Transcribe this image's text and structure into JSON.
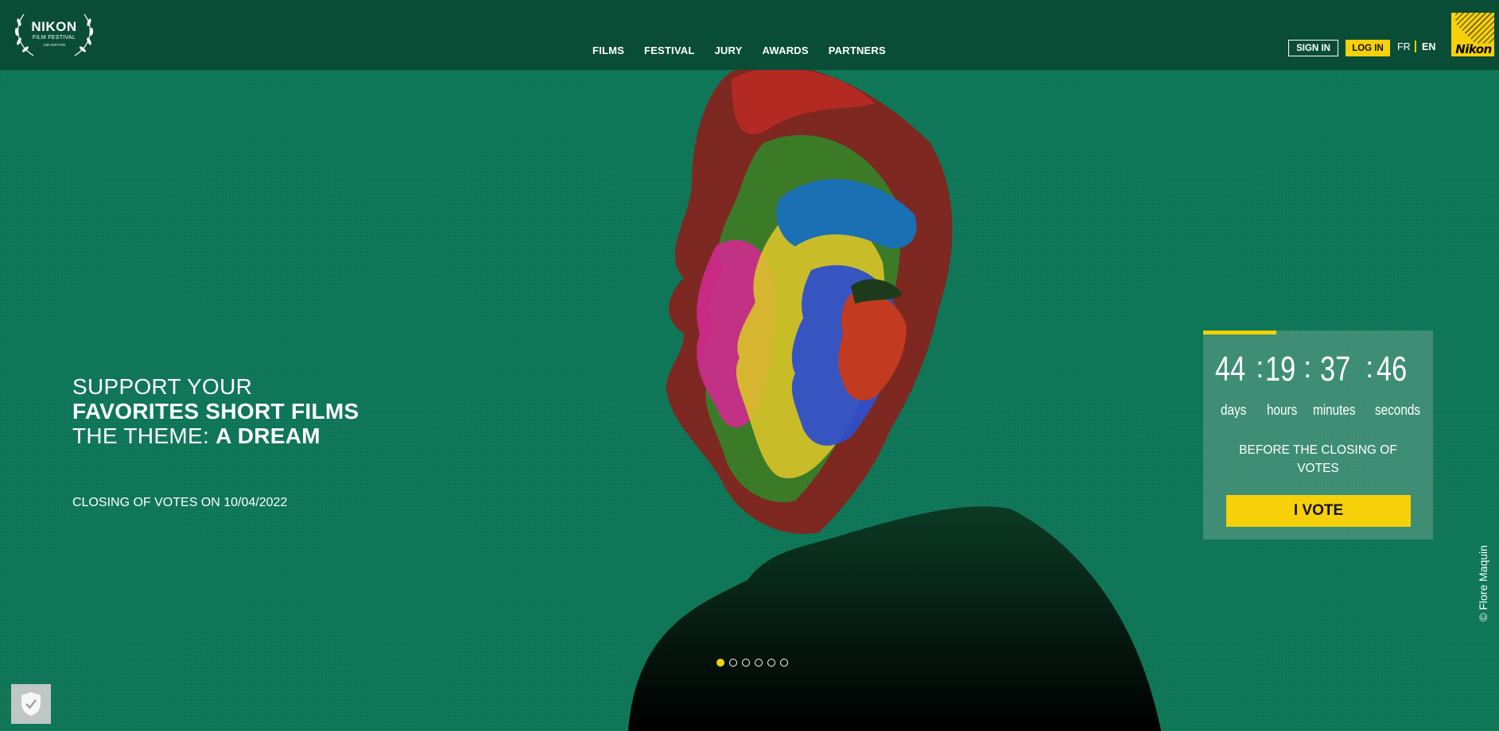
{
  "colors": {
    "accent": "#f6d10a",
    "header_bg": "#0a4d36",
    "hero_bg": "#10795a"
  },
  "logo": {
    "line1": "NIKON",
    "line2": "FILM FESTIVAL",
    "line3": "12th EDITION"
  },
  "nav": [
    "FILMS",
    "FESTIVAL",
    "JURY",
    "AWARDS",
    "PARTNERS"
  ],
  "account": {
    "sign_in": "SIGN IN",
    "log_in": "LOG IN"
  },
  "lang": {
    "fr": "FR",
    "en": "EN"
  },
  "brand": "Nikon",
  "hero": {
    "line1": "SUPPORT YOUR",
    "line2": "FAVORITES SHORT FILMS",
    "line3_prefix": "THE THEME: ",
    "line3_bold": "A DREAM",
    "closing": "CLOSING OF VOTES ON 10/04/2022"
  },
  "countdown": {
    "days": "44",
    "hours": "19",
    "minutes": "37",
    "seconds": "46",
    "sep": ":",
    "labels": {
      "days": "days",
      "hours": "hours",
      "minutes": "minutes",
      "seconds": "seconds"
    },
    "caption": "BEFORE THE CLOSING OF VOTES",
    "progress_fraction": 0.32,
    "vote_button": "I VOTE"
  },
  "credit": "© Flore Maquin",
  "slider": {
    "count": 6,
    "active_index": 0
  },
  "icons": {
    "privacy": "shield-check-icon"
  }
}
